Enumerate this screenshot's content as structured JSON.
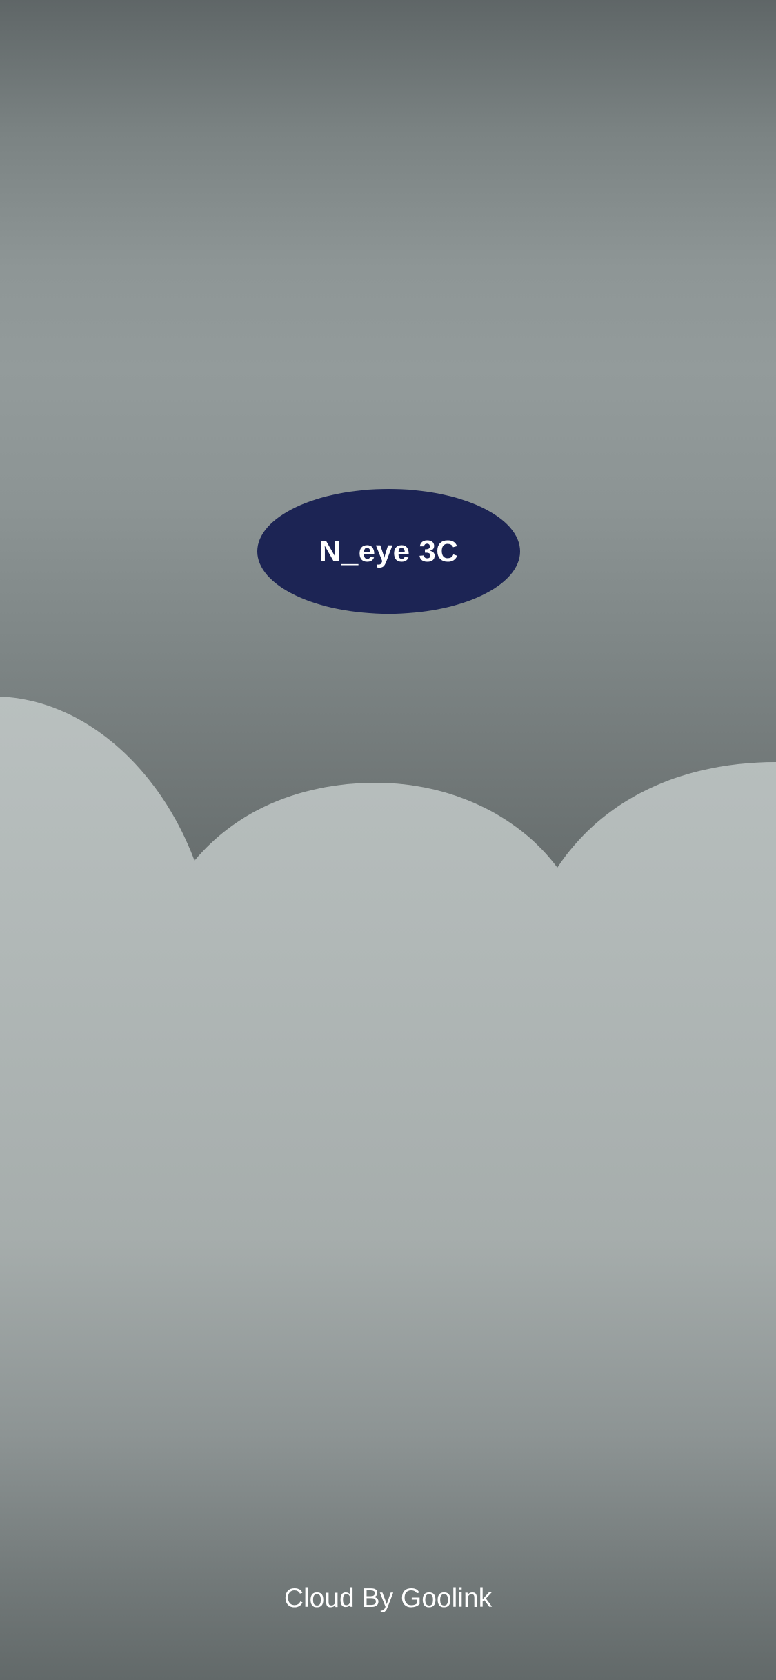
{
  "splash": {
    "app_name": "N_eye 3C",
    "footer": "Cloud By Goolink"
  },
  "colors": {
    "badge_background": "#1c2454",
    "text": "#ffffff",
    "sky_dark": "#5f6667",
    "sky_light": "#939b9b",
    "cloud_light": "#b6bdbc"
  },
  "icons": {
    "background": "cloud-illustration"
  }
}
